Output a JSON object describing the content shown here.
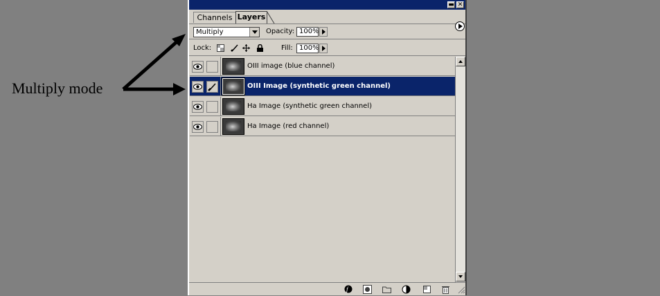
{
  "annotation": {
    "text": "Multiply mode"
  },
  "panel": {
    "tabs": [
      {
        "label": "Channels"
      },
      {
        "label": "Layers"
      }
    ],
    "blend_mode": "Multiply",
    "opacity_label": "Opacity:",
    "opacity_value": "100%",
    "lock_label": "Lock:",
    "fill_label": "Fill:",
    "fill_value": "100%",
    "layers": [
      {
        "name": "OIII image (blue channel)",
        "selected": false
      },
      {
        "name": "OIII Image (synthetic green channel)",
        "selected": true
      },
      {
        "name": "Ha Image (synthetic green channel)",
        "selected": false
      },
      {
        "name": "Ha Image (red channel)",
        "selected": false
      }
    ]
  },
  "colors": {
    "selection": "#0a246a",
    "panel": "#d4d0c8",
    "background": "#808080"
  }
}
